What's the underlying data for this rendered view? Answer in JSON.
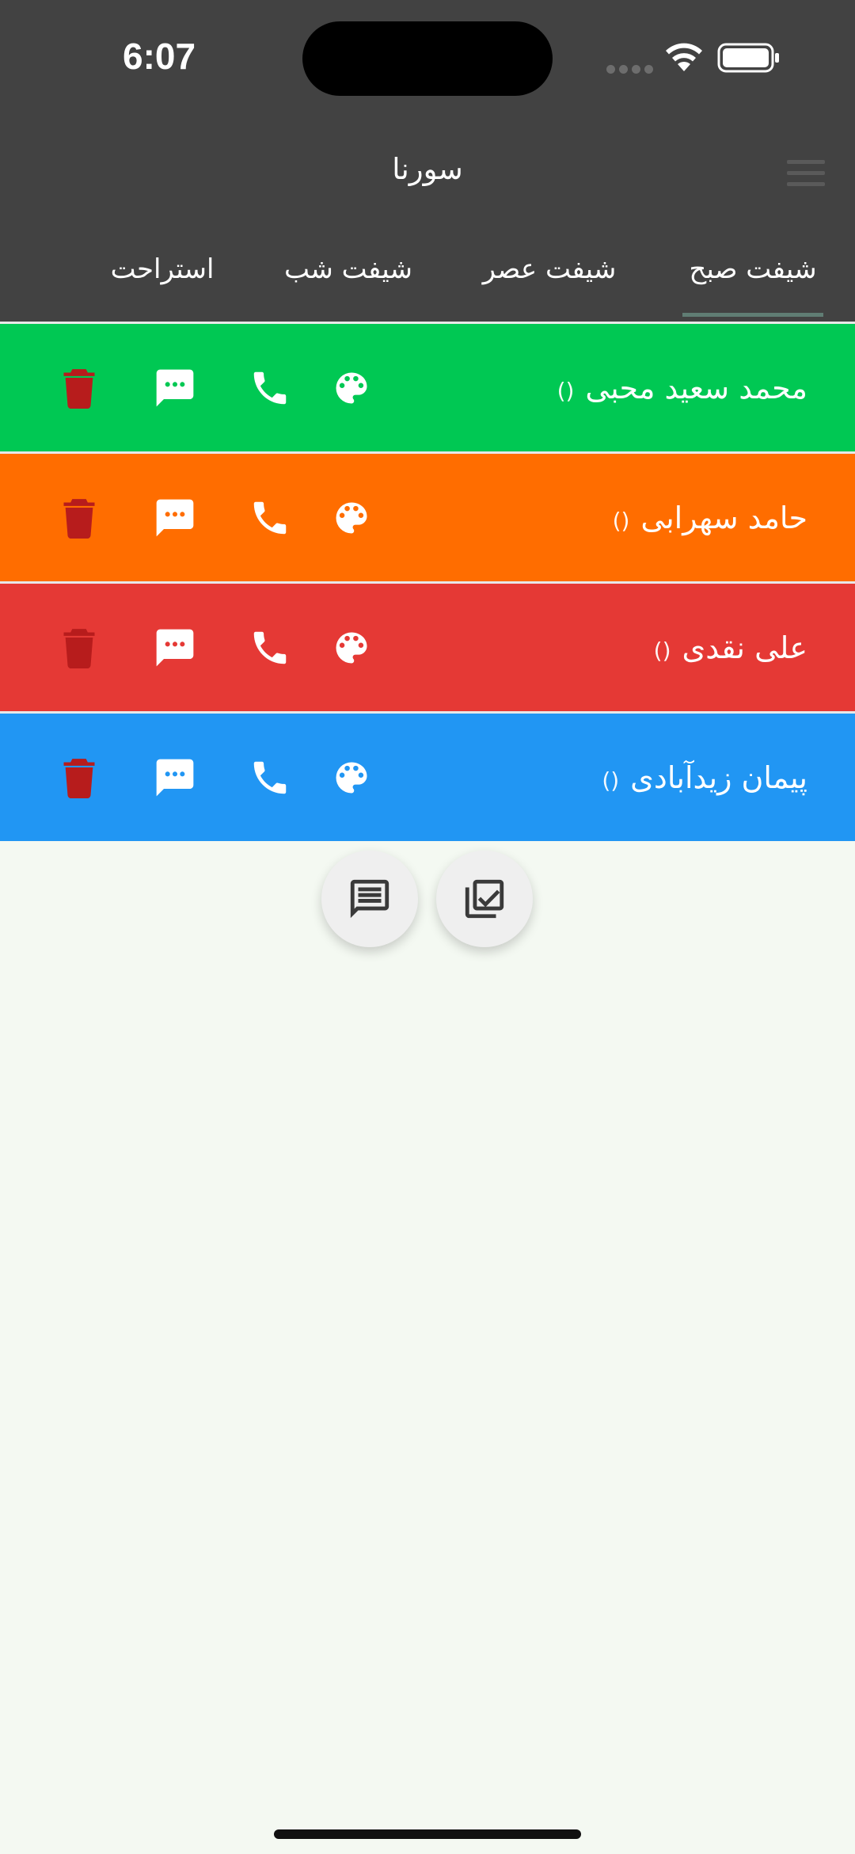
{
  "status_bar": {
    "time": "6:07"
  },
  "app": {
    "title": "سورنا"
  },
  "tabs": [
    {
      "label": "شیفت صبح",
      "active": true
    },
    {
      "label": "شیفت عصر",
      "active": false
    },
    {
      "label": "شیفت شب",
      "active": false
    },
    {
      "label": "استراحت",
      "active": false
    }
  ],
  "rows": [
    {
      "name": "محمد سعید محبی",
      "suffix": "()",
      "color": "#00c853"
    },
    {
      "name": "حامد سهرابی",
      "suffix": "()",
      "color": "#ff6d00"
    },
    {
      "name": "علی نقدی",
      "suffix": "()",
      "color": "#e53935"
    },
    {
      "name": "پیمان زیدآبادی",
      "suffix": "()",
      "color": "#2196f3"
    }
  ],
  "row_icons": [
    "palette-icon",
    "phone-icon",
    "message-icon",
    "trash-icon"
  ],
  "fabs": [
    "message-list-icon",
    "select-all-icon"
  ]
}
